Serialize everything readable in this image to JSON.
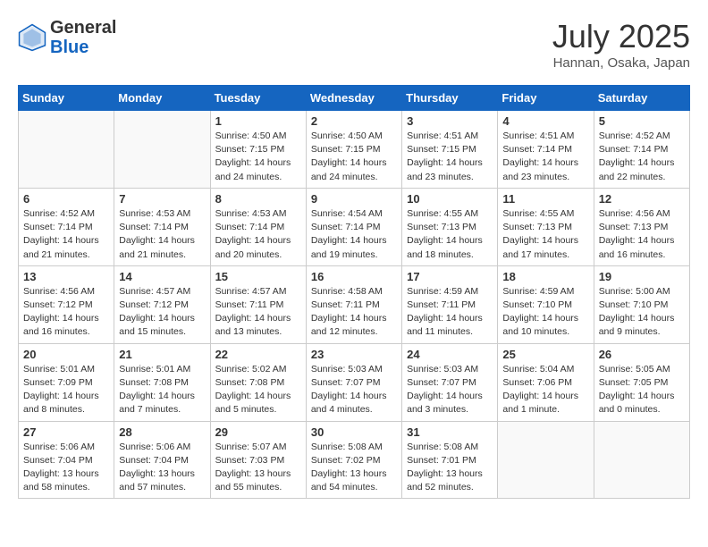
{
  "header": {
    "logo_general": "General",
    "logo_blue": "Blue",
    "month_title": "July 2025",
    "location": "Hannan, Osaka, Japan"
  },
  "weekdays": [
    "Sunday",
    "Monday",
    "Tuesday",
    "Wednesday",
    "Thursday",
    "Friday",
    "Saturday"
  ],
  "weeks": [
    [
      {
        "day": "",
        "info": ""
      },
      {
        "day": "",
        "info": ""
      },
      {
        "day": "1",
        "info": "Sunrise: 4:50 AM\nSunset: 7:15 PM\nDaylight: 14 hours and 24 minutes."
      },
      {
        "day": "2",
        "info": "Sunrise: 4:50 AM\nSunset: 7:15 PM\nDaylight: 14 hours and 24 minutes."
      },
      {
        "day": "3",
        "info": "Sunrise: 4:51 AM\nSunset: 7:15 PM\nDaylight: 14 hours and 23 minutes."
      },
      {
        "day": "4",
        "info": "Sunrise: 4:51 AM\nSunset: 7:14 PM\nDaylight: 14 hours and 23 minutes."
      },
      {
        "day": "5",
        "info": "Sunrise: 4:52 AM\nSunset: 7:14 PM\nDaylight: 14 hours and 22 minutes."
      }
    ],
    [
      {
        "day": "6",
        "info": "Sunrise: 4:52 AM\nSunset: 7:14 PM\nDaylight: 14 hours and 21 minutes."
      },
      {
        "day": "7",
        "info": "Sunrise: 4:53 AM\nSunset: 7:14 PM\nDaylight: 14 hours and 21 minutes."
      },
      {
        "day": "8",
        "info": "Sunrise: 4:53 AM\nSunset: 7:14 PM\nDaylight: 14 hours and 20 minutes."
      },
      {
        "day": "9",
        "info": "Sunrise: 4:54 AM\nSunset: 7:14 PM\nDaylight: 14 hours and 19 minutes."
      },
      {
        "day": "10",
        "info": "Sunrise: 4:55 AM\nSunset: 7:13 PM\nDaylight: 14 hours and 18 minutes."
      },
      {
        "day": "11",
        "info": "Sunrise: 4:55 AM\nSunset: 7:13 PM\nDaylight: 14 hours and 17 minutes."
      },
      {
        "day": "12",
        "info": "Sunrise: 4:56 AM\nSunset: 7:13 PM\nDaylight: 14 hours and 16 minutes."
      }
    ],
    [
      {
        "day": "13",
        "info": "Sunrise: 4:56 AM\nSunset: 7:12 PM\nDaylight: 14 hours and 16 minutes."
      },
      {
        "day": "14",
        "info": "Sunrise: 4:57 AM\nSunset: 7:12 PM\nDaylight: 14 hours and 15 minutes."
      },
      {
        "day": "15",
        "info": "Sunrise: 4:57 AM\nSunset: 7:11 PM\nDaylight: 14 hours and 13 minutes."
      },
      {
        "day": "16",
        "info": "Sunrise: 4:58 AM\nSunset: 7:11 PM\nDaylight: 14 hours and 12 minutes."
      },
      {
        "day": "17",
        "info": "Sunrise: 4:59 AM\nSunset: 7:11 PM\nDaylight: 14 hours and 11 minutes."
      },
      {
        "day": "18",
        "info": "Sunrise: 4:59 AM\nSunset: 7:10 PM\nDaylight: 14 hours and 10 minutes."
      },
      {
        "day": "19",
        "info": "Sunrise: 5:00 AM\nSunset: 7:10 PM\nDaylight: 14 hours and 9 minutes."
      }
    ],
    [
      {
        "day": "20",
        "info": "Sunrise: 5:01 AM\nSunset: 7:09 PM\nDaylight: 14 hours and 8 minutes."
      },
      {
        "day": "21",
        "info": "Sunrise: 5:01 AM\nSunset: 7:08 PM\nDaylight: 14 hours and 7 minutes."
      },
      {
        "day": "22",
        "info": "Sunrise: 5:02 AM\nSunset: 7:08 PM\nDaylight: 14 hours and 5 minutes."
      },
      {
        "day": "23",
        "info": "Sunrise: 5:03 AM\nSunset: 7:07 PM\nDaylight: 14 hours and 4 minutes."
      },
      {
        "day": "24",
        "info": "Sunrise: 5:03 AM\nSunset: 7:07 PM\nDaylight: 14 hours and 3 minutes."
      },
      {
        "day": "25",
        "info": "Sunrise: 5:04 AM\nSunset: 7:06 PM\nDaylight: 14 hours and 1 minute."
      },
      {
        "day": "26",
        "info": "Sunrise: 5:05 AM\nSunset: 7:05 PM\nDaylight: 14 hours and 0 minutes."
      }
    ],
    [
      {
        "day": "27",
        "info": "Sunrise: 5:06 AM\nSunset: 7:04 PM\nDaylight: 13 hours and 58 minutes."
      },
      {
        "day": "28",
        "info": "Sunrise: 5:06 AM\nSunset: 7:04 PM\nDaylight: 13 hours and 57 minutes."
      },
      {
        "day": "29",
        "info": "Sunrise: 5:07 AM\nSunset: 7:03 PM\nDaylight: 13 hours and 55 minutes."
      },
      {
        "day": "30",
        "info": "Sunrise: 5:08 AM\nSunset: 7:02 PM\nDaylight: 13 hours and 54 minutes."
      },
      {
        "day": "31",
        "info": "Sunrise: 5:08 AM\nSunset: 7:01 PM\nDaylight: 13 hours and 52 minutes."
      },
      {
        "day": "",
        "info": ""
      },
      {
        "day": "",
        "info": ""
      }
    ]
  ]
}
